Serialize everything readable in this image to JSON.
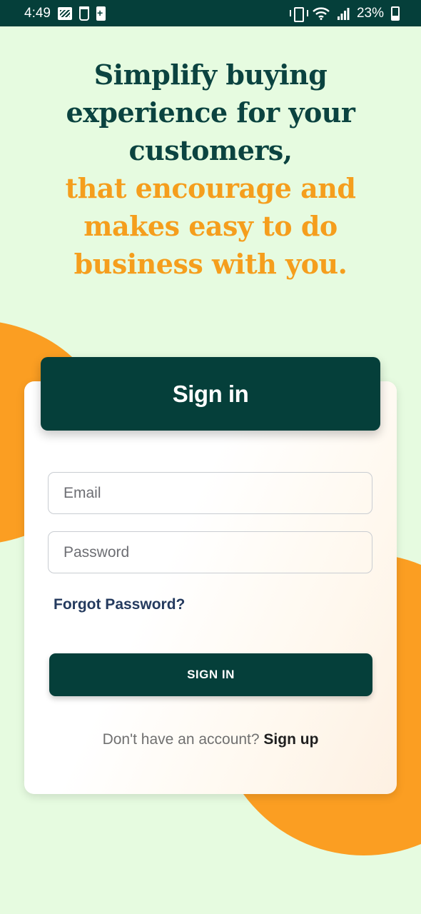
{
  "status_bar": {
    "time": "4:49",
    "battery_percent": "23%",
    "left_icons": [
      "gallery-icon",
      "flashlight-icon",
      "battery-saver-icon"
    ],
    "right_icons": [
      "vibrate-icon",
      "wifi-icon",
      "signal-icon",
      "battery-icon"
    ]
  },
  "headline": {
    "line1": "Simplify buying",
    "line2": "experience for your",
    "line3": "customers,",
    "line4": "that encourage and",
    "line5": "makes easy to do",
    "line6": "business with you."
  },
  "signin_card": {
    "title": "Sign in",
    "email_placeholder": "Email",
    "password_placeholder": "Password",
    "forgot_password": "Forgot Password?",
    "submit_label": "SIGN IN",
    "no_account_text": "Don't have an account?",
    "signup_link": "Sign up"
  },
  "colors": {
    "background": "#e6fbe0",
    "primary_dark": "#053f3a",
    "accent_orange": "#f59e1d",
    "blob_orange": "#fb9e22"
  }
}
